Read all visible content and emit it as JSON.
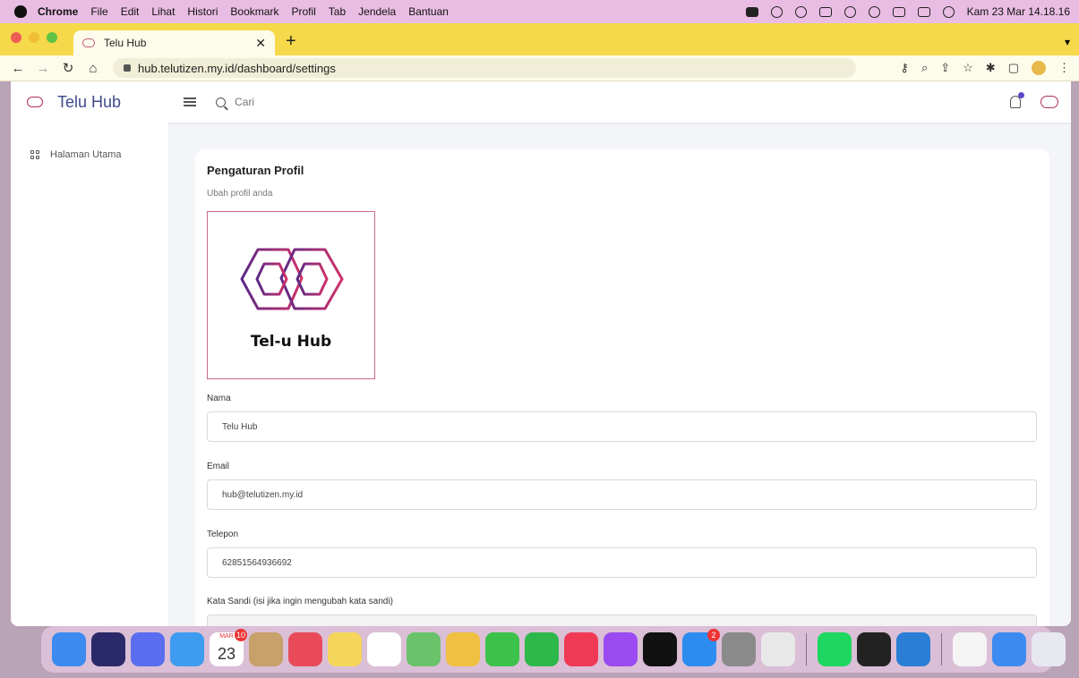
{
  "menubar": {
    "app": "Chrome",
    "items": [
      "File",
      "Edit",
      "Lihat",
      "Histori",
      "Bookmark",
      "Profil",
      "Tab",
      "Jendela",
      "Bantuan"
    ],
    "clock": "Kam 23 Mar 14.18.16"
  },
  "browser": {
    "tab_title": "Telu Hub",
    "url": "hub.telutizen.my.id/dashboard/settings"
  },
  "header": {
    "brand": "Telu Hub",
    "search_placeholder": "Cari"
  },
  "sidebar": {
    "items": [
      {
        "label": "Halaman Utama",
        "icon": "grid-icon"
      }
    ]
  },
  "profile": {
    "title": "Pengaturan Profil",
    "subtitle": "Ubah profil anda",
    "logo_text": "Tel-u Hub",
    "fields": [
      {
        "label": "Nama",
        "value": "Telu Hub"
      },
      {
        "label": "Email",
        "value": "hub@telutizen.my.id"
      },
      {
        "label": "Telepon",
        "value": "62851564936692"
      },
      {
        "label": "Kata Sandi (isi jika ingin mengubah kata sandi)",
        "value": ""
      }
    ]
  },
  "dock": {
    "calendar_month": "MAR",
    "calendar_day": "23",
    "calendar_badge": "10",
    "appstore_badge": "2",
    "apps": [
      {
        "name": "finder",
        "color": "#3d8bf0"
      },
      {
        "name": "siri",
        "color": "#2a2a6a"
      },
      {
        "name": "launchpad",
        "color": "#5a6df0"
      },
      {
        "name": "mail",
        "color": "#3d9cf0"
      },
      {
        "name": "calendar",
        "color": "#ffffff"
      },
      {
        "name": "contacts",
        "color": "#c8a06a"
      },
      {
        "name": "reminders-red",
        "color": "#e84a5a"
      },
      {
        "name": "notes",
        "color": "#f5d65a"
      },
      {
        "name": "reminders",
        "color": "#ffffff"
      },
      {
        "name": "maps",
        "color": "#6ac26a"
      },
      {
        "name": "photos",
        "color": "#f0c040"
      },
      {
        "name": "messages",
        "color": "#3cc24a"
      },
      {
        "name": "facetime",
        "color": "#2eb84a"
      },
      {
        "name": "music",
        "color": "#f03a55"
      },
      {
        "name": "podcasts",
        "color": "#9a4af0"
      },
      {
        "name": "tv",
        "color": "#111111"
      },
      {
        "name": "app-store",
        "color": "#2d8cf0"
      },
      {
        "name": "system-settings",
        "color": "#8a8a8a"
      },
      {
        "name": "chrome",
        "color": "#e8e8e8"
      },
      {
        "name": "spotify",
        "color": "#1ed760"
      },
      {
        "name": "terminal",
        "color": "#222222"
      },
      {
        "name": "vscode",
        "color": "#2a7ed6"
      },
      {
        "name": "telu-hub",
        "color": "#f5f5f5"
      },
      {
        "name": "downloads",
        "color": "#3d8bf0"
      },
      {
        "name": "trash",
        "color": "#e8e8f0"
      }
    ]
  },
  "colors": {
    "brand": "#3e4a8c",
    "logo_gradient_start": "#5b2a86",
    "logo_gradient_end": "#d0306a",
    "tabbar": "#f6d94a",
    "menubar": "#e9bde3"
  }
}
